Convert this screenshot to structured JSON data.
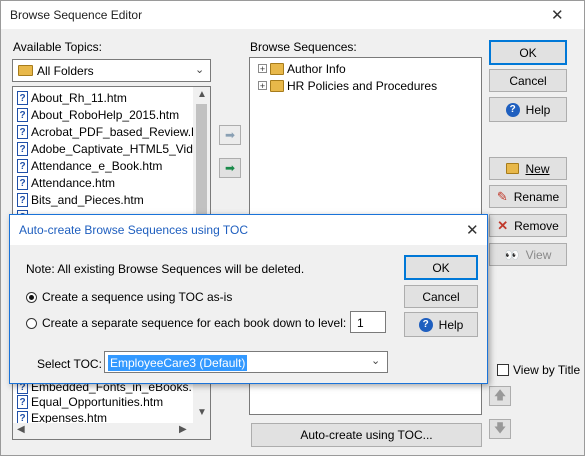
{
  "window": {
    "title": "Browse Sequence Editor",
    "close_glyph": "✕"
  },
  "available_topics": {
    "label": "Available Topics:",
    "folder_selector": "All Folders",
    "items": [
      "About_Rh_11.htm",
      "About_RoboHelp_2015.htm",
      "Acrobat_PDF_based_Review.l",
      "Adobe_Captivate_HTML5_Vid",
      "Attendance_e_Book.htm",
      "Attendance.htm",
      "Bits_and_Pieces.htm",
      "Embedded_Fonts_in_eBooks.",
      "Equal_Opportunities.htm",
      "Expenses.htm"
    ]
  },
  "browse_sequences": {
    "label": "Browse Sequences:",
    "items": [
      "Author Info",
      "HR Policies and Procedures"
    ],
    "autocreate_button": "Auto-create using TOC..."
  },
  "side_buttons": {
    "ok": "OK",
    "cancel": "Cancel",
    "help": "Help",
    "new": "New",
    "rename": "Rename",
    "remove": "Remove",
    "view": "View"
  },
  "view_by_title": "View by Title",
  "modal": {
    "title": "Auto-create Browse Sequences using TOC",
    "close_glyph": "✕",
    "note": "Note: All existing Browse Sequences will be deleted.",
    "option_as_is": "Create a sequence using TOC as-is",
    "option_per_book": "Create a separate sequence for each book down to level:",
    "level_value": "1",
    "select_toc_label": "Select TOC:",
    "select_toc_value": "EmployeeCare3 (Default)",
    "ok": "OK",
    "cancel": "Cancel",
    "help": "Help"
  },
  "icons": {
    "add_arrow": "arrow-right-icon",
    "add_all": "arrow-right-plus-icon",
    "up": "arrow-up-icon",
    "down": "arrow-down-icon"
  },
  "colors": {
    "accent": "#0078d7",
    "selection": "#3399ff",
    "doc_icon": "#1f4fa8"
  }
}
